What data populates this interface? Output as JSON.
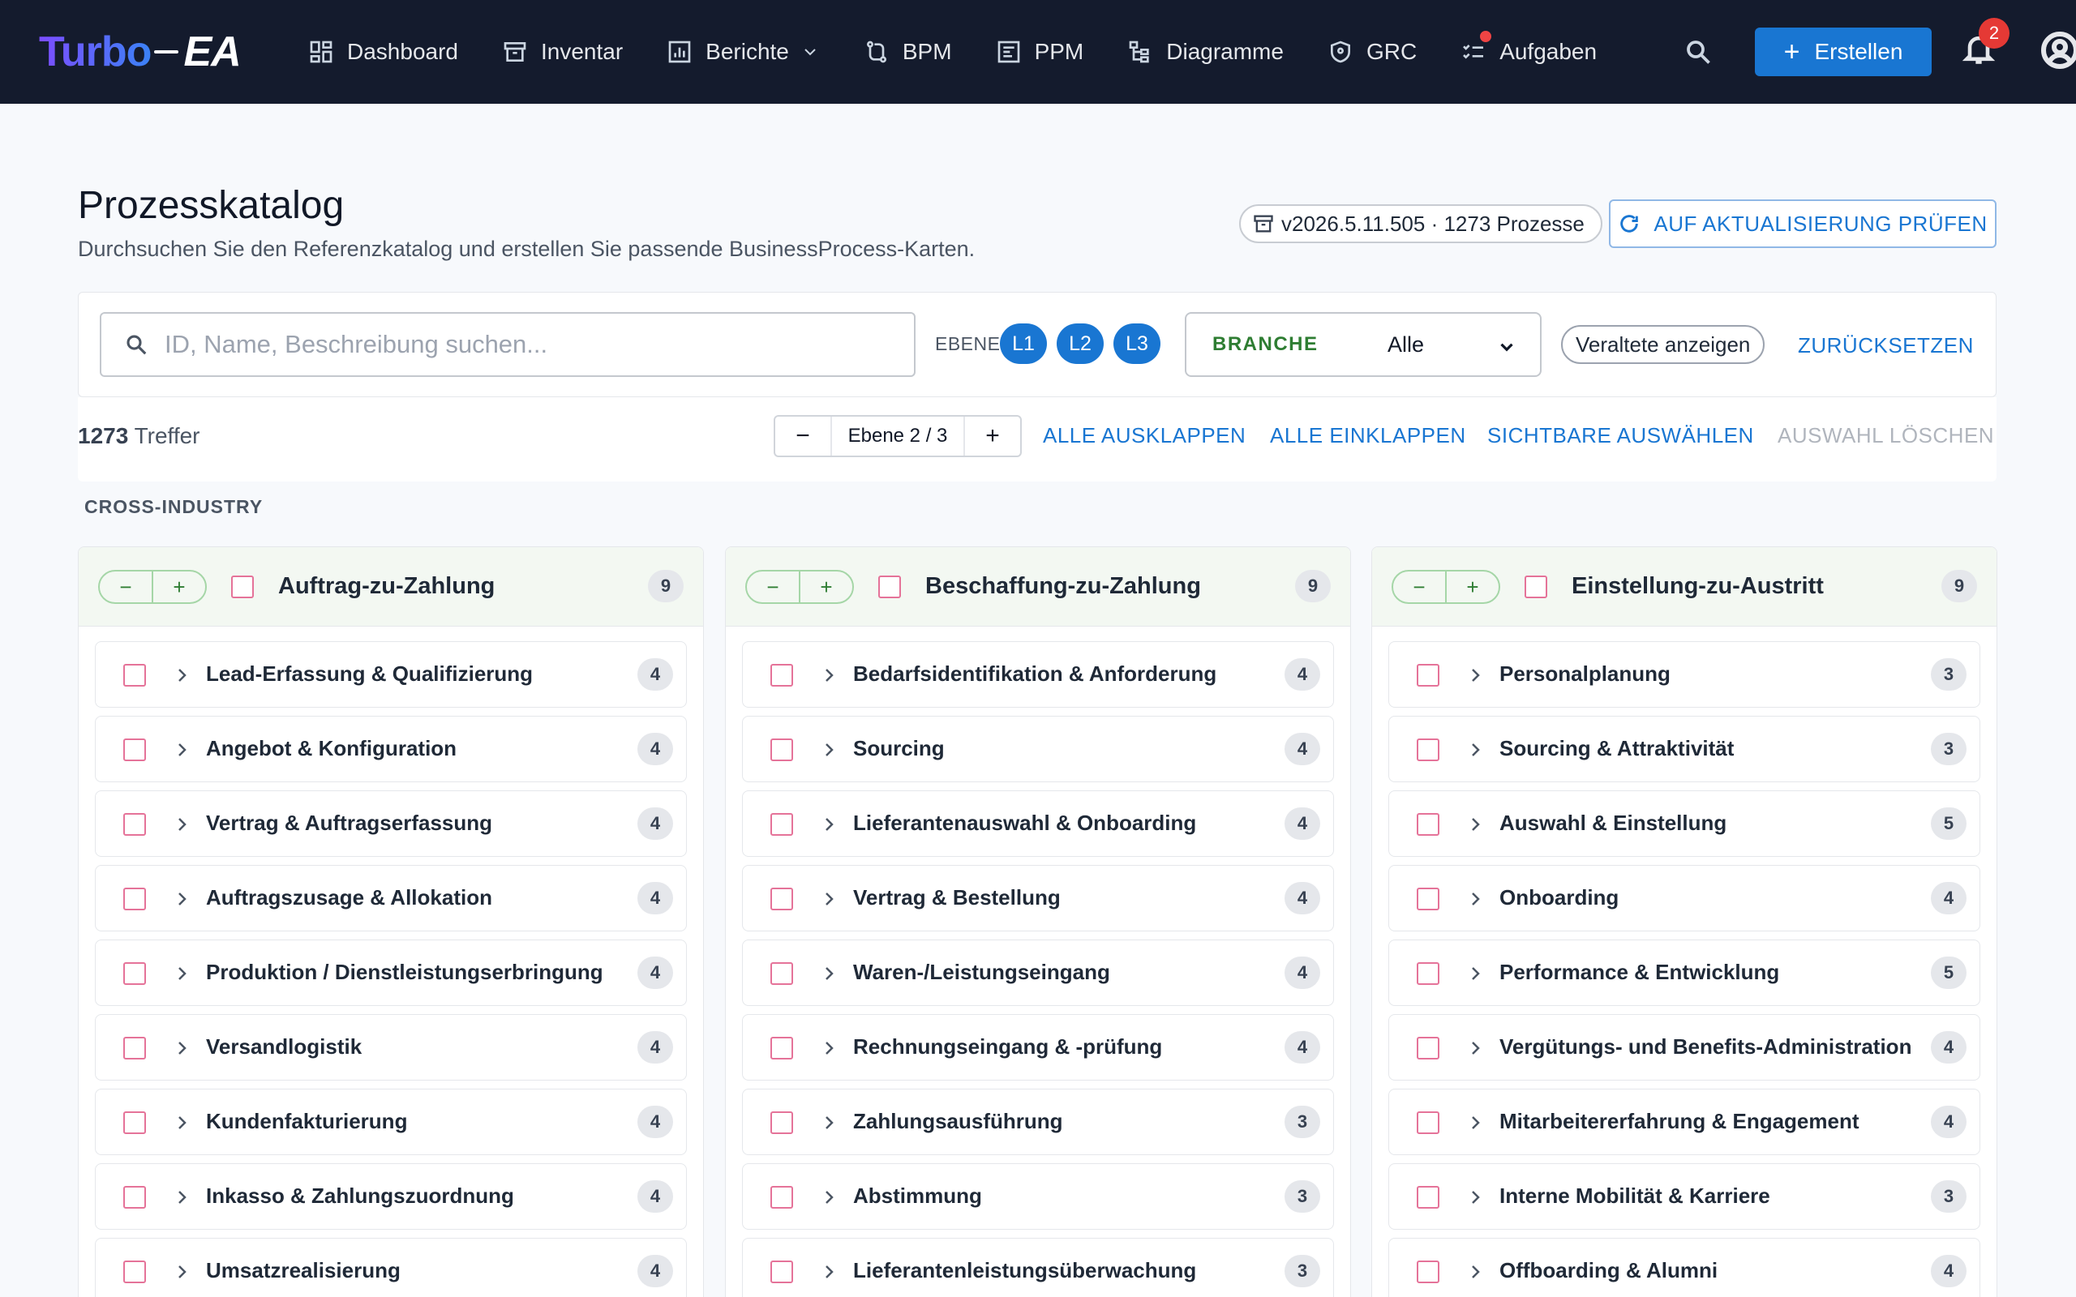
{
  "logo": {
    "part1": "Turbo",
    "part2": "EA"
  },
  "nav": [
    {
      "label": "Dashboard",
      "icon": "dashboard-icon"
    },
    {
      "label": "Inventar",
      "icon": "archive-icon"
    },
    {
      "label": "Berichte",
      "icon": "chart-icon"
    },
    {
      "label": "BPM",
      "icon": "flow-icon"
    },
    {
      "label": "PPM",
      "icon": "project-icon"
    },
    {
      "label": "Diagramme",
      "icon": "diagram-icon"
    },
    {
      "label": "GRC",
      "icon": "shield-icon"
    },
    {
      "label": "Aufgaben",
      "icon": "tasks-icon"
    }
  ],
  "header": {
    "create_label": "Erstellen",
    "notifications_count": "2"
  },
  "page": {
    "title": "Prozesskatalog",
    "subtitle": "Durchsuchen Sie den Referenzkatalog und erstellen Sie passende BusinessProcess-Karten.",
    "version": "v2026.5.11.505 · 1273 Prozesse",
    "update_label": "AUF AKTUALISIERUNG PRÜFEN"
  },
  "filters": {
    "search_placeholder": "ID, Name, Beschreibung suchen...",
    "level_label": "EBENE",
    "levels": [
      "L1",
      "L2",
      "L3"
    ],
    "branche_label": "BRANCHE",
    "branche_value": "Alle",
    "outdated_label": "Veraltete anzeigen",
    "reset_label": "ZURÜCKSETZEN"
  },
  "toolbar": {
    "hits_count": "1273",
    "hits_label": "Treffer",
    "level_minus": "−",
    "level_value": "Ebene 2 / 3",
    "level_plus": "+",
    "expand_all": "ALLE AUSKLAPPEN",
    "collapse_all": "ALLE EINKLAPPEN",
    "select_visible": "SICHTBARE AUSWÄHLEN",
    "clear_selection": "AUSWAHL LÖSCHEN"
  },
  "section": {
    "label": "CROSS-INDUSTRY"
  },
  "columns": [
    {
      "title": "Auftrag-zu-Zahlung",
      "count": "9",
      "items": [
        {
          "label": "Lead-Erfassung & Qualifizierung",
          "count": "4"
        },
        {
          "label": "Angebot & Konfiguration",
          "count": "4"
        },
        {
          "label": "Vertrag & Auftragserfassung",
          "count": "4"
        },
        {
          "label": "Auftragszusage & Allokation",
          "count": "4"
        },
        {
          "label": "Produktion / Dienstleistungserbringung",
          "count": "4"
        },
        {
          "label": "Versandlogistik",
          "count": "4"
        },
        {
          "label": "Kundenfakturierung",
          "count": "4"
        },
        {
          "label": "Inkasso & Zahlungszuordnung",
          "count": "4"
        },
        {
          "label": "Umsatzrealisierung",
          "count": "4"
        }
      ]
    },
    {
      "title": "Beschaffung-zu-Zahlung",
      "count": "9",
      "items": [
        {
          "label": "Bedarfsidentifikation & Anforderung",
          "count": "4"
        },
        {
          "label": "Sourcing",
          "count": "4"
        },
        {
          "label": "Lieferantenauswahl & Onboarding",
          "count": "4"
        },
        {
          "label": "Vertrag & Bestellung",
          "count": "4"
        },
        {
          "label": "Waren-/Leistungseingang",
          "count": "4"
        },
        {
          "label": "Rechnungseingang & -prüfung",
          "count": "4"
        },
        {
          "label": "Zahlungsausführung",
          "count": "3"
        },
        {
          "label": "Abstimmung",
          "count": "3"
        },
        {
          "label": "Lieferantenleistungsüberwachung",
          "count": "3"
        }
      ]
    },
    {
      "title": "Einstellung-zu-Austritt",
      "count": "9",
      "items": [
        {
          "label": "Personalplanung",
          "count": "3"
        },
        {
          "label": "Sourcing & Attraktivität",
          "count": "3"
        },
        {
          "label": "Auswahl & Einstellung",
          "count": "5"
        },
        {
          "label": "Onboarding",
          "count": "4"
        },
        {
          "label": "Performance & Entwicklung",
          "count": "5"
        },
        {
          "label": "Vergütungs- und Benefits-Administration",
          "count": "4"
        },
        {
          "label": "Mitarbeitererfahrung & Engagement",
          "count": "4"
        },
        {
          "label": "Interne Mobilität & Karriere",
          "count": "3"
        },
        {
          "label": "Offboarding & Alumni",
          "count": "4"
        }
      ]
    }
  ]
}
